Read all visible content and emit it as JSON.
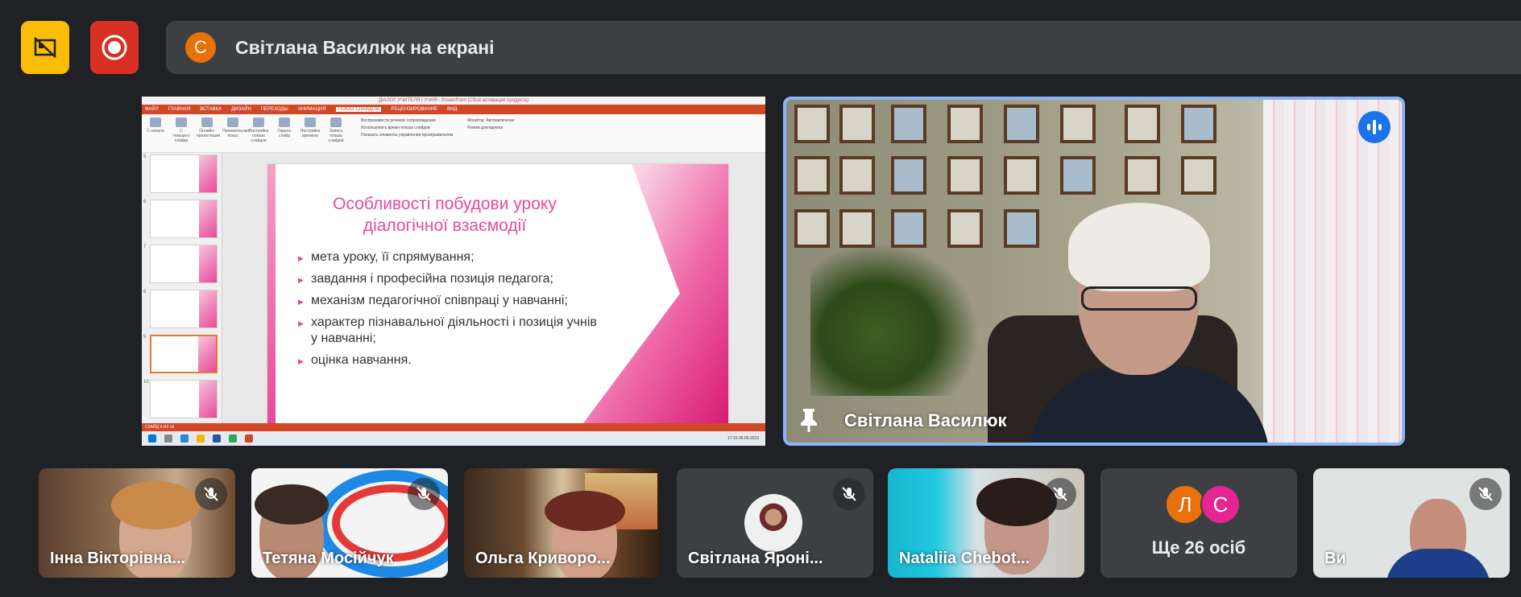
{
  "presenter_bar": {
    "avatar_letter": "С",
    "text": "Світлана Василюк на екрані",
    "avatar_color": "#e8710a"
  },
  "top_buttons": {
    "presenting_color": "#fbbc04",
    "record_color": "#d93025"
  },
  "shared_screen": {
    "ppt_window_title": "ДІАЛОГ УЧИТЕЛЯ І УЧНЯ - PowerPoint (Сбой активации продукта)",
    "ribbon_tabs": [
      "ФАЙЛ",
      "ГЛАВНАЯ",
      "ВСТАВКА",
      "ДИЗАЙН",
      "ПЕРЕХОДЫ",
      "АНИМАЦИЯ",
      "ПОКАЗ СЛАЙДОВ",
      "РЕЦЕНЗИРОВАНИЕ",
      "ВИД"
    ],
    "ribbon_buttons": [
      "С начала",
      "С текущего слайда",
      "Онлайн-презентация",
      "Произвольный показ",
      "Настройка показа слайдов",
      "Скрыть слайд",
      "Настройка времени",
      "Запись показа слайдов"
    ],
    "ribbon_checks": [
      "Воспроизвести речевое сопровождение",
      "Использовать время показа слайдов",
      "Показать элементы управления проигрывателем"
    ],
    "monitor_label": "Монитор: Автоматически",
    "presenter_view_label": "Режим докладчика",
    "thumb_numbers": [
      "5",
      "6",
      "7",
      "8",
      "9",
      "10"
    ],
    "slide": {
      "title": "Особливості побудови уроку діалогічної взаємодії",
      "bullets": [
        "мета уроку, її спрямування;",
        "завдання і професійна позиція педагога;",
        "механізм педагогічної співпраці у навчанні;",
        "характер пізнавальної діяльності і позиція учнів у навчанні;",
        "оцінка навчання."
      ]
    },
    "status_text": "СЛАЙД 9 ИЗ 16",
    "clock": "17:16 05.05.2023"
  },
  "main_speaker": {
    "name": "Світлана Василюк",
    "border_color": "#8ab4f8",
    "speaking_color": "#1a73e8"
  },
  "participants": [
    {
      "name": "Інна Вікторівна..."
    },
    {
      "name": "Тетяна Мосійчук"
    },
    {
      "name": "Ольга Криворо..."
    },
    {
      "name": "Світлана Яроні..."
    },
    {
      "name": "Nataliia Chebot..."
    },
    {
      "more_label": "Ще 26 осіб",
      "avatars": [
        {
          "letter": "Л",
          "color": "#e8710a"
        },
        {
          "letter": "С",
          "color": "#e52592"
        }
      ]
    },
    {
      "name": "Ви"
    }
  ],
  "icons": {
    "presenting": "present-to-all-off-icon",
    "record": "record-icon",
    "pin": "pin-icon",
    "speaking": "speaking-indicator-icon",
    "mic_off": "mic-off-icon"
  }
}
